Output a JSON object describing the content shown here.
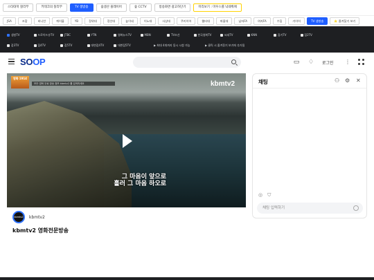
{
  "topbar": {
    "chips": [
      "스타대학 찰리부",
      "키테크의 찰리부",
      "TV 생방송",
      "숲생산 플레이어",
      "숲 CCTV",
      "방송화면 광고하단기",
      "미리보기 : 마우스를 낙네뤄에"
    ]
  },
  "bar2": {
    "pills": [
      "JSA",
      "조합",
      "비니언",
      "케이블",
      "YB",
      "정위대",
      "정선대",
      "높이네",
      "이노대",
      "사상대",
      "쿠키이어",
      "웹터대",
      "파울대",
      "남자FA",
      "여자FA",
      "수집",
      "가이어",
      "TV 생방송"
    ],
    "favorite": "⭐ 즐겨찾기 보기"
  },
  "channels": {
    "row1": [
      "생방TV",
      "드로이드슈TV",
      "JTBC",
      "YTN",
      "영화뉴스TV",
      "MBN",
      "TV조선",
      "한국영화TV",
      "씨네TV",
      "KNN",
      "잡기TV",
      "잡2TV"
    ],
    "row2": [
      "잡3TV",
      "잡4TV",
      "잡5TV",
      "대변잡4TV",
      "대변잡5TV",
      "▶ 최대 4개까지 동시 시청 가능",
      "▶ 클릭 시 즐겨찾기 보기에 추가됨"
    ]
  },
  "header": {
    "logo_a": "SO",
    "logo_b": "OP",
    "login": "로그인"
  },
  "video": {
    "badge": "영화 1914",
    "ticker": "모든 영화 무료 방송 정보 kbmtv2 를 검색하세요",
    "logo": "kbmtv2",
    "subtitle_line1": "그 마음이 앞으로",
    "subtitle_line2": "흘러 그 마음 하오로"
  },
  "channel": {
    "avatar_text": "kbmtv2",
    "name": "kbmtv2",
    "broadcast_title": "kbmtv2 영화전문방송"
  },
  "chat": {
    "title": "채팅",
    "input_placeholder": "채팅 입력하기"
  },
  "colors": {
    "accent": "#1f5eff",
    "dark": "#1e1f22"
  }
}
